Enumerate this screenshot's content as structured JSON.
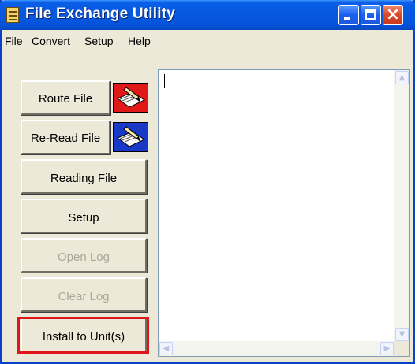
{
  "window": {
    "title": "File Exchange Utility"
  },
  "menu": {
    "items": [
      "File",
      "Convert",
      "Setup",
      "Help"
    ]
  },
  "buttons": {
    "route_file": "Route File",
    "reread_file": "Re-Read File",
    "reading_file": "Reading File",
    "setup": "Setup",
    "open_log": "Open Log",
    "clear_log": "Clear Log",
    "install": "Install to Unit(s)"
  },
  "output": {
    "text": ""
  },
  "colors": {
    "title_bar": "#0654dc",
    "highlight": "#e0161c",
    "route_icon_bg": "#e01818",
    "reread_icon_bg": "#1838c8"
  }
}
